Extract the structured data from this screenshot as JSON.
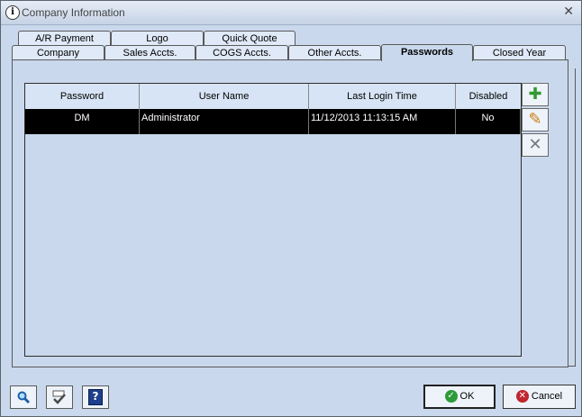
{
  "window": {
    "title": "Company Information",
    "close_glyph": "✕",
    "info_glyph": "i"
  },
  "tabs_back": [
    {
      "label": "A/R Payment"
    },
    {
      "label": "Logo"
    },
    {
      "label": "Quick Quote"
    }
  ],
  "tabs_front": [
    {
      "label": "Company"
    },
    {
      "label": "Sales Accts."
    },
    {
      "label": "COGS Accts."
    },
    {
      "label": "Other Accts."
    },
    {
      "label": "Passwords",
      "active": true
    },
    {
      "label": "Closed Year"
    }
  ],
  "grid": {
    "columns": [
      "Password",
      "User Name",
      "Last Login Time",
      "Disabled"
    ],
    "rows": [
      {
        "password": "DM",
        "user_name": "Administrator",
        "last_login": "11/12/2013 11:13:15 AM",
        "disabled": "No"
      }
    ]
  },
  "side_buttons": [
    {
      "icon": "plus-icon",
      "glyph": "✚",
      "color": "#2f9a2f"
    },
    {
      "icon": "pencil-icon",
      "glyph": "✎",
      "color": "#c77a12"
    },
    {
      "icon": "x-icon",
      "glyph": "✕",
      "color": "#777777"
    }
  ],
  "bottom_buttons": [
    {
      "icon": "search-icon",
      "glyph": "🔍"
    },
    {
      "icon": "spellcheck-icon",
      "glyph": "✓"
    },
    {
      "icon": "help-icon",
      "glyph": "?"
    }
  ],
  "actions": {
    "ok_label": "OK",
    "cancel_label": "Cancel",
    "ok_color": "#2e9b3a",
    "cancel_color": "#c0262d"
  }
}
